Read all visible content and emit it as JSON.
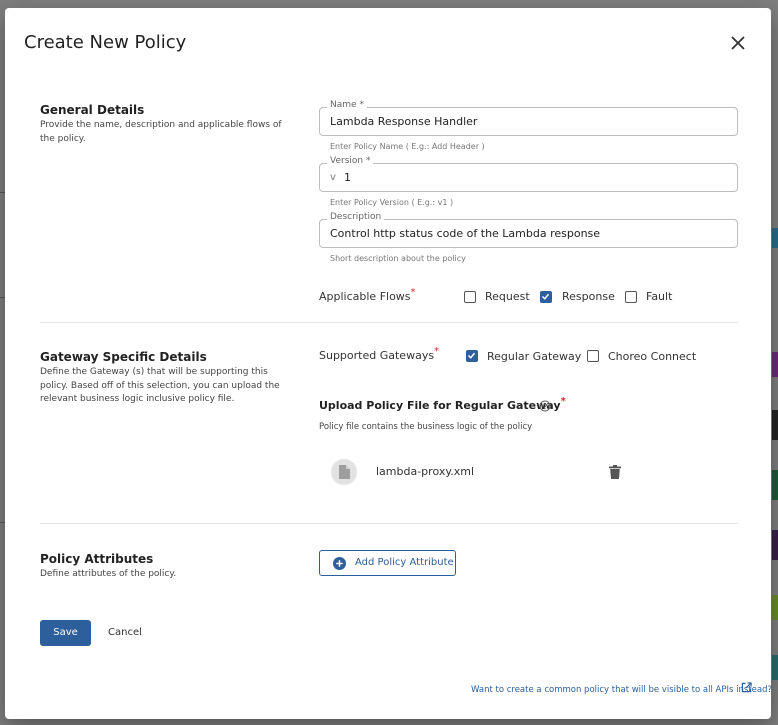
{
  "dialog": {
    "title": "Create New Policy"
  },
  "general": {
    "title": "General Details",
    "description": "Provide the name, description and applicable flows of the policy.",
    "name_field": {
      "label": "Name",
      "required_mark": "*",
      "value": "Lambda Response Handler",
      "helper": "Enter Policy Name ( E.g.: Add Header )"
    },
    "version_field": {
      "label": "Version",
      "required_mark": "*",
      "prefix": "v",
      "value": "1",
      "helper": "Enter Policy Version ( E.g.: v1 )"
    },
    "description_field": {
      "label": "Description",
      "value": "Control http status code of the Lambda response",
      "helper": "Short description about the policy"
    },
    "flows": {
      "label": "Applicable Flows",
      "required_mark": "*",
      "options": [
        {
          "label": "Request",
          "checked": false
        },
        {
          "label": "Response",
          "checked": true
        },
        {
          "label": "Fault",
          "checked": false
        }
      ]
    }
  },
  "gateway": {
    "title": "Gateway Specific Details",
    "description": "Define the Gateway (s) that will be supporting this policy. Based off of this selection, you can upload the relevant business logic inclusive policy file.",
    "supported": {
      "label": "Supported Gateways",
      "required_mark": "*",
      "options": [
        {
          "label": "Regular Gateway",
          "checked": true
        },
        {
          "label": "Choreo Connect",
          "checked": false
        }
      ]
    },
    "upload": {
      "title": "Upload Policy File for Regular Gateway",
      "required_mark": "*",
      "description": "Policy file contains the business logic of the policy",
      "file_name": "lambda-proxy.xml"
    }
  },
  "attributes": {
    "title": "Policy Attributes",
    "description": "Define attributes of the policy.",
    "add_button": "Add Policy Attribute"
  },
  "actions": {
    "save": "Save",
    "cancel": "Cancel"
  },
  "footer": {
    "link": "Want to create a common policy that will be visible to all APIs instead?"
  },
  "colors": {
    "primary": "#2c5f9b",
    "required": "#d32f2f"
  }
}
